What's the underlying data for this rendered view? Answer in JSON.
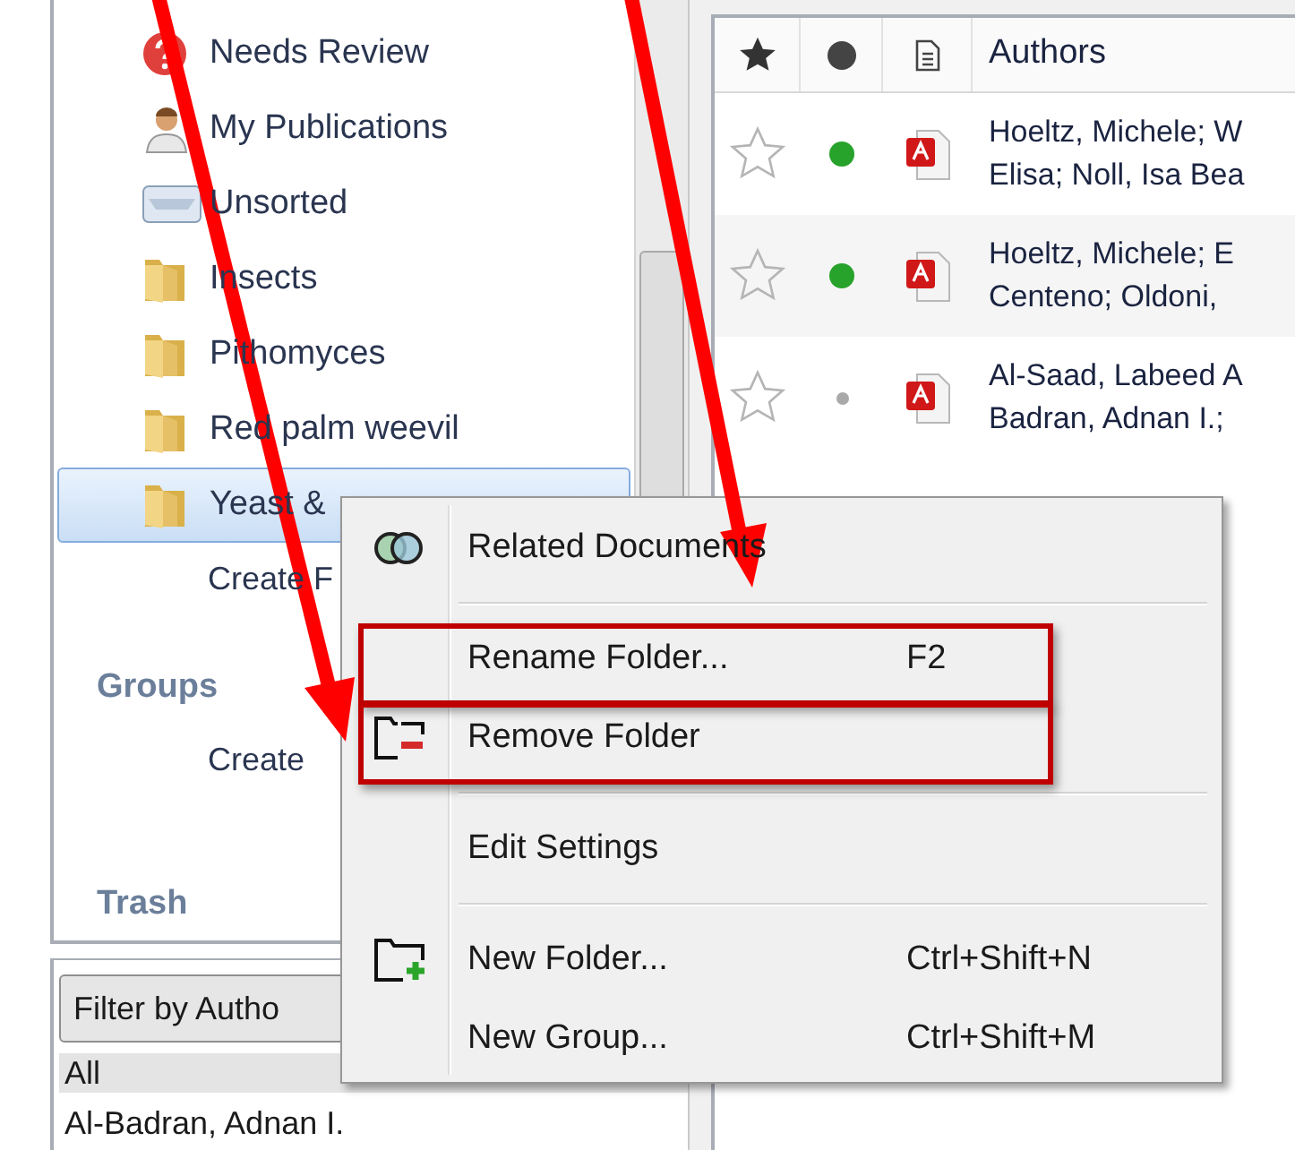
{
  "sidebar": {
    "items": [
      {
        "kind": "needs-review",
        "label": "Needs Review",
        "selected": false
      },
      {
        "kind": "publications",
        "label": "My Publications",
        "selected": false
      },
      {
        "kind": "unsorted",
        "label": "Unsorted",
        "selected": false
      },
      {
        "kind": "folder",
        "label": "Insects",
        "selected": false
      },
      {
        "kind": "folder",
        "label": "Pithomyces",
        "selected": false
      },
      {
        "kind": "folder",
        "label": "Red palm weevil",
        "selected": false
      },
      {
        "kind": "folder",
        "label": "Yeast &",
        "selected": true
      }
    ],
    "create_folder": "Create F",
    "groups_heading": "Groups",
    "create_group": "Create",
    "trash_heading": "Trash"
  },
  "author_filter": {
    "dropdown": "Filter by Autho",
    "items": [
      {
        "label": "All",
        "selected": true
      },
      {
        "label": "Al-Badran, Adnan I.",
        "selected": false
      }
    ]
  },
  "documents": {
    "authors_heading": "Authors",
    "rows": [
      {
        "starred": false,
        "unread": true,
        "authors": [
          "Hoeltz, Michele; W",
          "Elisa; Noll, Isa Bea"
        ]
      },
      {
        "starred": false,
        "unread": true,
        "authors": [
          "Hoeltz, Michele; E",
          "Centeno; Oldoni,"
        ]
      },
      {
        "starred": false,
        "unread": false,
        "authors": [
          "Al-Saad, Labeed A",
          "Badran, Adnan I.;"
        ]
      }
    ]
  },
  "context_menu": {
    "items": [
      {
        "kind": "related",
        "label": "Related Documents",
        "highlighted": false
      },
      {
        "kind": "separator"
      },
      {
        "kind": "plain",
        "label": "Rename Folder...",
        "shortcut": "F2",
        "highlighted": true
      },
      {
        "kind": "remove-folder",
        "label": "Remove Folder",
        "highlighted": true
      },
      {
        "kind": "separator"
      },
      {
        "kind": "plain",
        "label": "Edit Settings",
        "highlighted": false
      },
      {
        "kind": "separator"
      },
      {
        "kind": "new-folder",
        "label": "New Folder...",
        "shortcut": "Ctrl+Shift+N",
        "highlighted": false
      },
      {
        "kind": "plain",
        "label": "New Group...",
        "shortcut": "Ctrl+Shift+M",
        "highlighted": false
      }
    ]
  }
}
